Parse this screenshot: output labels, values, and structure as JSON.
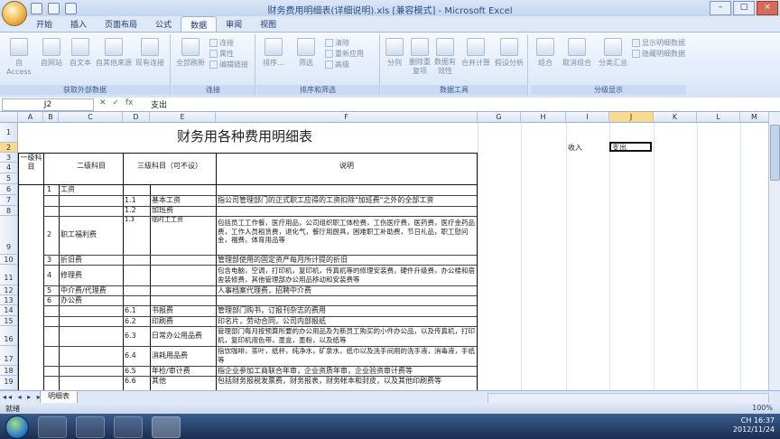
{
  "window": {
    "title": "财务费用明细表(详细说明).xls [兼容模式] - Microsoft Excel",
    "controls": [
      "–",
      "□",
      "×"
    ]
  },
  "tabs": [
    "开始",
    "插入",
    "页面布局",
    "公式",
    "数据",
    "审阅",
    "视图"
  ],
  "active_tab": "数据",
  "ribbon": {
    "groups": [
      {
        "label": "获取外部数据",
        "buttons": [
          "自 Access",
          "自网站",
          "自文本",
          "自其他来源",
          "现有连接"
        ]
      },
      {
        "label": "连接",
        "buttons": [
          "全部刷新"
        ],
        "small": [
          "连接",
          "属性",
          "编辑链接"
        ]
      },
      {
        "label": "排序和筛选",
        "buttons": [
          "排序...",
          "筛选"
        ],
        "small": [
          "清除",
          "重新应用",
          "高级"
        ]
      },
      {
        "label": "数据工具",
        "buttons": [
          "分列",
          "删除重复项",
          "数据有效性",
          "合并计算",
          "假设分析"
        ]
      },
      {
        "label": "分级显示",
        "buttons": [
          "组合",
          "取消组合",
          "分类汇总"
        ],
        "small": [
          "显示明细数据",
          "隐藏明细数据"
        ]
      }
    ]
  },
  "formula_bar": {
    "name_box": "J2",
    "icons": [
      "✕",
      "✓",
      "fx"
    ],
    "content": "支出"
  },
  "columns": [
    "A",
    "B",
    "C",
    "D",
    "E",
    "F",
    "G",
    "H",
    "I",
    "J",
    "K",
    "L",
    "M"
  ],
  "selected_column": "J",
  "rows": [
    "1",
    "2",
    "3",
    "4",
    "5",
    "6",
    "7",
    "8",
    "9",
    "10",
    "11",
    "12",
    "13",
    "14",
    "15",
    "16",
    "17",
    "18",
    "19"
  ],
  "selected_row": "2",
  "sheet": {
    "title": "财务用各种费用明细表",
    "header": {
      "level1": "一级科目",
      "level2": "二级科目",
      "level3": "三级科目（可不设）",
      "desc": "说明"
    },
    "side": {
      "income_label": "收入",
      "expense_value": "支出"
    },
    "items": [
      {
        "row": "6",
        "num": "1",
        "name": "工资",
        "code": "",
        "sub": "",
        "desc": ""
      },
      {
        "row": "7",
        "num": "",
        "name": "",
        "code": "1.1",
        "sub": "基本工资",
        "desc": "指公司管理部门的正式职工应得的工资扣除\"加班费\"之外的全部工资"
      },
      {
        "row": "8",
        "num": "",
        "name": "",
        "code": "1.2",
        "sub": "加班费",
        "desc": ""
      },
      {
        "row": "8b",
        "num": "",
        "name": "",
        "code": "1.3",
        "sub": "临时工工资",
        "desc": ""
      },
      {
        "row": "9",
        "num": "2",
        "name": "职工福利费",
        "code": "",
        "sub": "",
        "desc": "包括员工工作餐，医疗用品，公司组织职工体检费，工伤医疗费，医药费，医疗金药品费，工作人员租赁费，退化气，餐厅用厨具，困难职工补助费，节日礼品，职工慰问金，福费，体育用品等"
      },
      {
        "row": "10",
        "num": "3",
        "name": "折旧费",
        "code": "",
        "sub": "",
        "desc": "管理部使用的固定资产每月所计提的折旧"
      },
      {
        "row": "11",
        "num": "4",
        "name": "修理费",
        "code": "",
        "sub": "",
        "desc": "包含电脑，空调，打印机，复印机，传真机等的修理安装费，硬件升级费，办公楼和宿舍装修费，其他管理部办公用品移动和安装费等"
      },
      {
        "row": "12",
        "num": "5",
        "name": "中介费/代理费",
        "code": "",
        "sub": "",
        "desc": "人事档案代理费，招聘中介费"
      },
      {
        "row": "13",
        "num": "6",
        "name": "办公费",
        "code": "",
        "sub": "",
        "desc": ""
      },
      {
        "row": "14",
        "num": "",
        "name": "",
        "code": "6.1",
        "sub": "书报费",
        "desc": "管理部门购书，订报刊杂志的费用"
      },
      {
        "row": "15",
        "num": "",
        "name": "",
        "code": "6.2",
        "sub": "印刷费",
        "desc": "印名片，劳动合同，公司内部报纸"
      },
      {
        "row": "16",
        "num": "",
        "name": "",
        "code": "6.3",
        "sub": "日常办公用品费",
        "desc": "管理部门每月按预算所要的办公用品及为新员工购买的小件办公品，以及传真机，打印机，复印机用色带，墨盒，墨粉，以及纸等"
      },
      {
        "row": "17",
        "num": "",
        "name": "",
        "code": "6.4",
        "sub": "消耗用品费",
        "desc": "指饮咖啡，茶叶，纸杯，纯净水，矿泉水，纸巾以及洗手间用的洗手液，消毒液，手纸等"
      },
      {
        "row": "18",
        "num": "",
        "name": "",
        "code": "6.5",
        "sub": "年检/审计费",
        "desc": "指企业参加工商联合年审，企业资质年审，企业验资审计费等"
      },
      {
        "row": "19",
        "num": "",
        "name": "",
        "code": "6.6",
        "sub": "其他",
        "desc": "包括财务报税发票费，财务报表，财务帐本和封皮，以及其他印刷费等"
      }
    ]
  },
  "sheet_tabs": [
    "明细表"
  ],
  "status": {
    "ready": "就绪",
    "zoom": "100%"
  },
  "tray": {
    "lang": "CH",
    "time": "16:37",
    "date": "2012/11/24"
  },
  "colors": {
    "accent": "#f9d98f",
    "ribbon": "#d7e4f6",
    "taskbar": "#1b2f52"
  }
}
